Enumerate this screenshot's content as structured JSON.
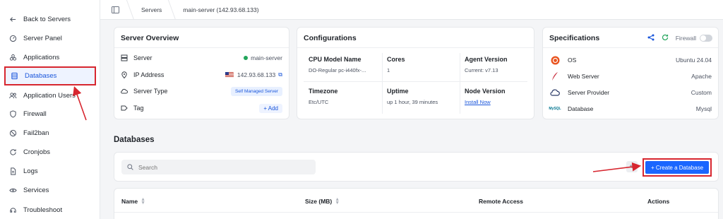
{
  "sidebar": {
    "items": [
      {
        "label": "Back to Servers",
        "icon": "arrow-left-icon"
      },
      {
        "label": "Server Panel",
        "icon": "gauge-icon"
      },
      {
        "label": "Applications",
        "icon": "apps-icon"
      },
      {
        "label": "Databases",
        "icon": "database-icon",
        "active": true
      },
      {
        "label": "Application Users",
        "icon": "users-icon"
      },
      {
        "label": "Firewall",
        "icon": "shield-icon"
      },
      {
        "label": "Fail2ban",
        "icon": "ban-icon"
      },
      {
        "label": "Cronjobs",
        "icon": "cron-icon"
      },
      {
        "label": "Logs",
        "icon": "file-icon"
      },
      {
        "label": "Services",
        "icon": "services-icon"
      },
      {
        "label": "Troubleshoot",
        "icon": "troubleshoot-icon"
      }
    ]
  },
  "topbar": {
    "crumb1": "Servers",
    "crumb2": "main-server (142.93.68.133)"
  },
  "overview": {
    "title": "Server Overview",
    "server_label": "Server",
    "server_value": "main-server",
    "ip_label": "IP Address",
    "ip_value": "142.93.68.133",
    "type_label": "Server Type",
    "type_value": "Self Managed Server",
    "tag_label": "Tag",
    "tag_add": "+ Add"
  },
  "config": {
    "title": "Configurations",
    "cpu_label": "CPU Model Name",
    "cpu_value": "DO-Regular pc-i440fx-...",
    "cores_label": "Cores",
    "cores_value": "1",
    "agent_label": "Agent Version",
    "agent_value": "Current: v7.13",
    "tz_label": "Timezone",
    "tz_value": "Etc/UTC",
    "uptime_label": "Uptime",
    "uptime_value": "up 1 hour, 39 minutes",
    "node_label": "Node Version",
    "node_value": "Install Now"
  },
  "specs": {
    "title": "Specifications",
    "firewall_label": "Firewall",
    "firewall_on": false,
    "rows": [
      {
        "label": "OS",
        "value": "Ubuntu 24.04"
      },
      {
        "label": "Web Server",
        "value": "Apache"
      },
      {
        "label": "Server Provider",
        "value": "Custom"
      },
      {
        "label": "Database",
        "value": "Mysql"
      }
    ],
    "mysql_logo_text": "MySQL"
  },
  "databases": {
    "title": "Databases",
    "search_placeholder": "Search",
    "create_label": "+ Create a Database",
    "columns": [
      "Name",
      "Size (MB)",
      "Remote Access",
      "Actions"
    ]
  },
  "colors": {
    "accent": "#1a66ff",
    "highlight": "#d7262f",
    "online": "#22a55b"
  }
}
